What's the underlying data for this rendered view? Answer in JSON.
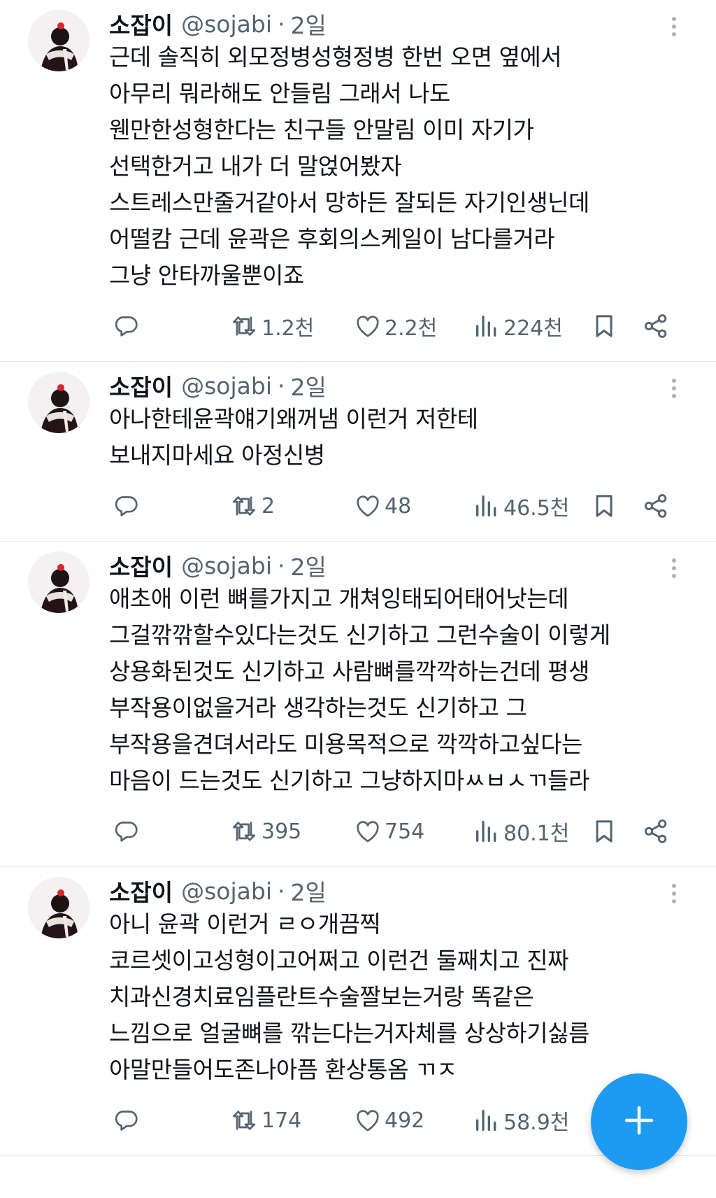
{
  "tweets": [
    {
      "name": "소잡이",
      "handle": "@sojabi",
      "separator": "·",
      "time": "2일",
      "text": "근데 솔직히 외모정병성형정병 한번 오면 옆에서\n아무리 뭐라해도 안들림  그래서 나도\n웬만한성형한다는 친구들 안말림   이미 자기가\n선택한거고 내가 더 말얹어봤자\n스트레스만줄거같아서  망하든 잘되든 자기인생닌데\n어떨캄   근데 윤곽은 후회의스케일이 남다를거라\n그냥 안타까울뿐이죠",
      "retweets": "1.2천",
      "likes": "2.2천",
      "views": "224천"
    },
    {
      "name": "소잡이",
      "handle": "@sojabi",
      "separator": "·",
      "time": "2일",
      "text": "아나한테윤곽얘기왜꺼냄  이런거 저한테\n보내지마세요 아정신병",
      "retweets": "2",
      "likes": "48",
      "views": "46.5천"
    },
    {
      "name": "소잡이",
      "handle": "@sojabi",
      "separator": "·",
      "time": "2일",
      "text": "애초애 이런 뼈를가지고 개쳐잉태되어태어낫는데\n그걸깎깎할수있다는것도 신기하고 그런수술이 이렇게\n상용화된것도 신기하고 사람뼈를깍깍하는건데 평생\n부작용이없을거라 생각하는것도 신기하고 그\n부작용을견뎌서라도 미용목적으로 깍깍하고싶다는\n마음이 드는것도 신기하고 그냥하지마ㅆㅂㅅㄲ들라",
      "retweets": "395",
      "likes": "754",
      "views": "80.1천"
    },
    {
      "name": "소잡이",
      "handle": "@sojabi",
      "separator": "·",
      "time": "2일",
      "text": "아니 윤곽 이런거 ㄹㅇ개끔찍\n코르셋이고성형이고어쩌고 이런건 둘째치고  진짜\n치과신경치료임플란트수술짤보는거랑 똑같은\n느낌으로  얼굴뼈를 깎는다는거자체를 상상하기싫름\n아말만들어도존나아픔 환상통옴 ㄲㅈ",
      "retweets": "174",
      "likes": "492",
      "views": "58.9천"
    }
  ],
  "icons": {
    "reply": "reply-icon",
    "retweet": "retweet-icon",
    "like": "heart-icon",
    "views": "views-icon",
    "bookmark": "bookmark-icon",
    "share": "share-icon",
    "more": "more-options-icon",
    "compose": "plus-icon"
  },
  "colors": {
    "accent": "#1d9bf0",
    "text": "#0f1419",
    "secondary": "#536471",
    "divider": "#e6e9ec"
  }
}
